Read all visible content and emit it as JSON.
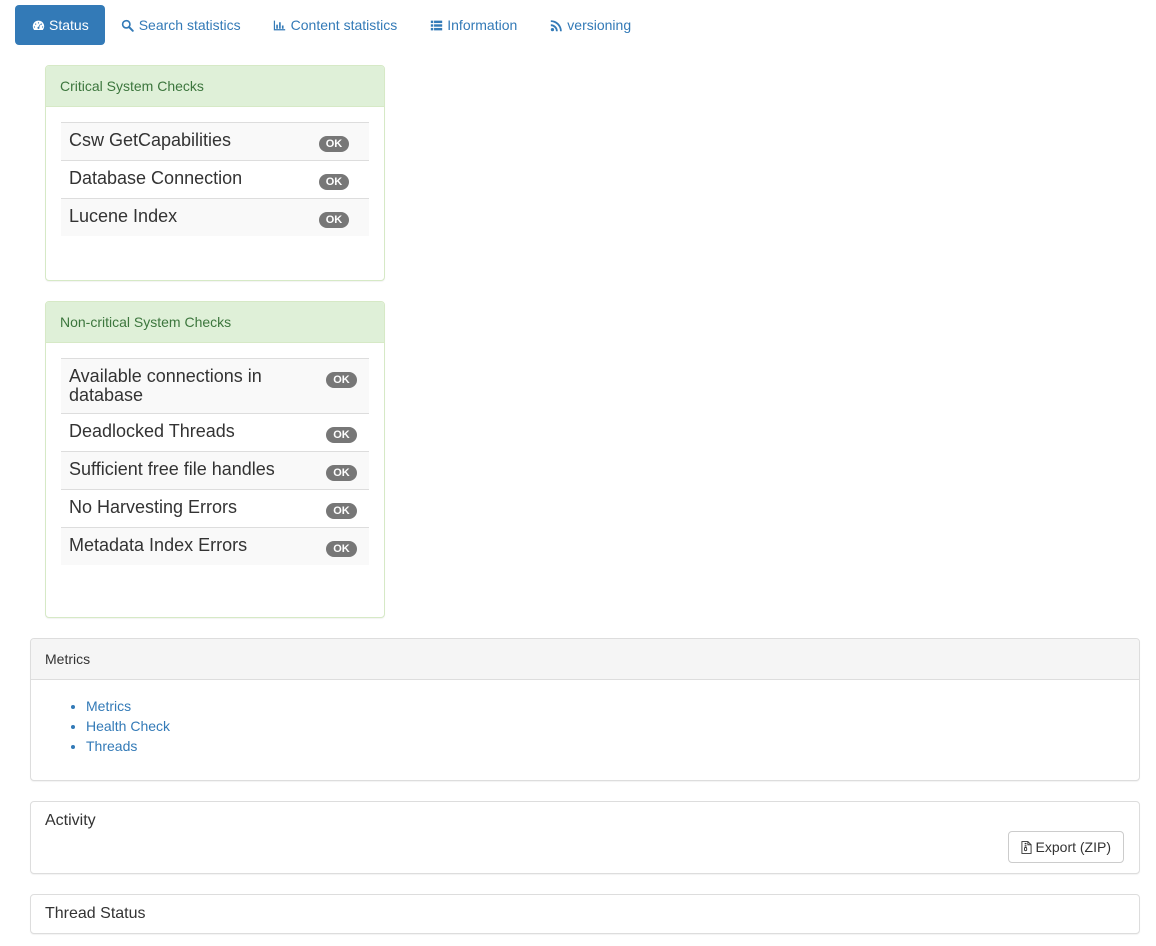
{
  "tabs": [
    {
      "label": "Status",
      "icon": "dashboard-icon",
      "active": true
    },
    {
      "label": "Search statistics",
      "icon": "search-icon"
    },
    {
      "label": "Content statistics",
      "icon": "bar-chart-icon"
    },
    {
      "label": "Information",
      "icon": "list-icon"
    },
    {
      "label": "versioning",
      "icon": "rss-icon"
    }
  ],
  "critical": {
    "title": "Critical System Checks",
    "checks": [
      {
        "name": "Csw GetCapabilities",
        "status": "OK"
      },
      {
        "name": "Database Connection",
        "status": "OK"
      },
      {
        "name": "Lucene Index",
        "status": "OK"
      }
    ]
  },
  "noncritical": {
    "title": "Non-critical System Checks",
    "checks": [
      {
        "name": "Available connections in database",
        "status": "OK"
      },
      {
        "name": "Deadlocked Threads",
        "status": "OK"
      },
      {
        "name": "Sufficient free file handles",
        "status": "OK"
      },
      {
        "name": "No Harvesting Errors",
        "status": "OK"
      },
      {
        "name": "Metadata Index Errors",
        "status": "OK"
      }
    ]
  },
  "metrics": {
    "title": "Metrics",
    "links": [
      "Metrics",
      "Health Check",
      "Threads"
    ]
  },
  "activity": {
    "title": "Activity",
    "export_label": "Export (ZIP)"
  },
  "thread_status": {
    "title": "Thread Status"
  },
  "colors": {
    "primary": "#337ab7",
    "success_bg": "#dff0d8",
    "success_text": "#3c763d",
    "badge": "#777777"
  }
}
